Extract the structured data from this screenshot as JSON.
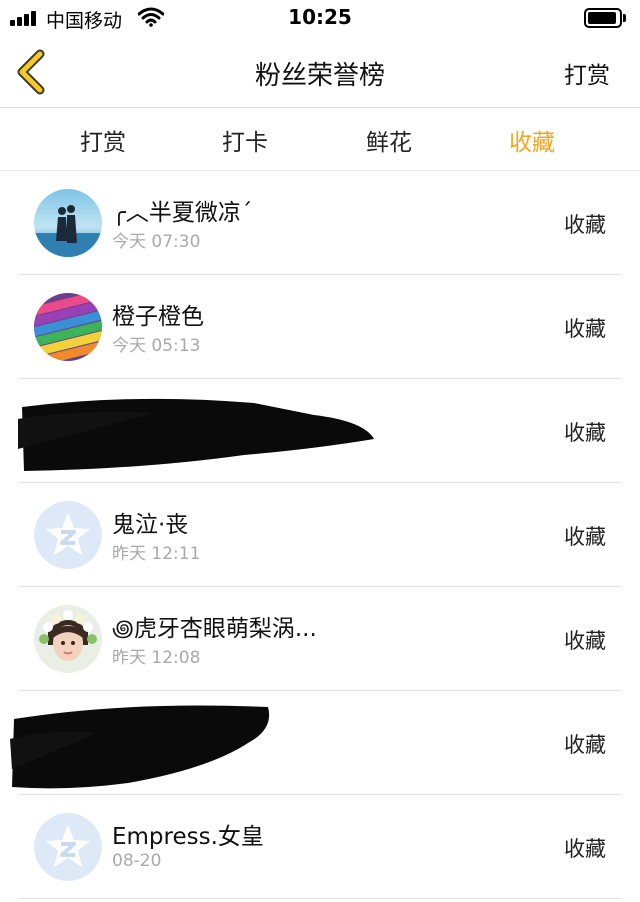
{
  "status_bar": {
    "carrier": "中国移动",
    "time": "10:25"
  },
  "nav": {
    "title": "粉丝荣誉榜",
    "action": "打赏"
  },
  "tabs": [
    {
      "label": "打赏",
      "active": false
    },
    {
      "label": "打卡",
      "active": false
    },
    {
      "label": "鲜花",
      "active": false
    },
    {
      "label": "收藏",
      "active": true
    }
  ],
  "colors": {
    "accent": "#f0a823",
    "default_avatar": "#dde9f6"
  },
  "fans": [
    {
      "name": "╭︿半夏微凉ˊ",
      "date": "今天 07:30",
      "action": "收藏",
      "avatar": "couple-photo",
      "redacted": false
    },
    {
      "name": "橙子橙色",
      "date": "今天 05:13",
      "action": "收藏",
      "avatar": "colored-pencils-photo",
      "redacted": false
    },
    {
      "name": "",
      "date": "",
      "action": "收藏",
      "avatar": "",
      "redacted": true
    },
    {
      "name": "鬼泣·丧",
      "date": "昨天 12:11",
      "action": "收藏",
      "avatar": "default-avatar",
      "redacted": false
    },
    {
      "name": "꩜虎牙杏眼萌梨涡...",
      "date": "昨天 12:08",
      "action": "收藏",
      "avatar": "flower-crown-photo",
      "redacted": false
    },
    {
      "name": "",
      "date": "",
      "action": "收藏",
      "avatar": "",
      "redacted": true
    },
    {
      "name": "Empress.女皇",
      "date": "08-20",
      "action": "收藏",
      "avatar": "default-avatar",
      "redacted": false
    }
  ]
}
